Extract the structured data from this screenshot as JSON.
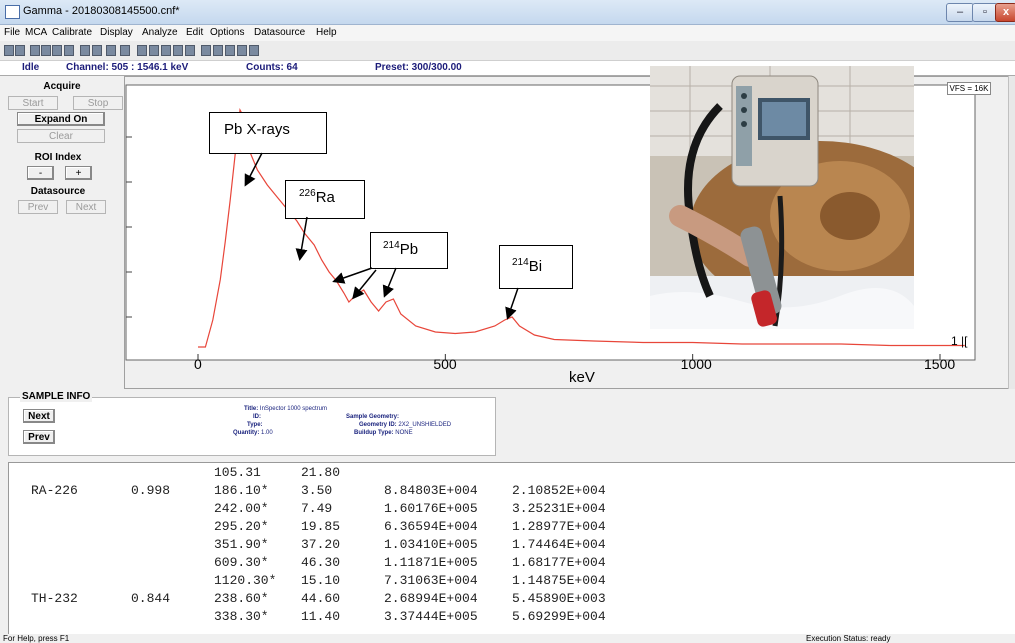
{
  "window": {
    "title": "Gamma - 20180308145500.cnf*",
    "min": "–",
    "max": "▫",
    "close": "x"
  },
  "menu": [
    "File",
    "MCA",
    "Calibrate",
    "Display",
    "Analyze",
    "Edit",
    "Options",
    "Datasource",
    "Help"
  ],
  "status": {
    "state": "Idle",
    "channel": "Channel: 505  : 1546.1 keV",
    "counts": "Counts: 64",
    "preset": "Preset: 300/300.00"
  },
  "acquire": {
    "heading": "Acquire",
    "start": "Start",
    "stop": "Stop",
    "expand": "Expand On",
    "clear": "Clear"
  },
  "roi": {
    "heading": "ROI Index",
    "minus": "-",
    "plus": "+"
  },
  "datasource": {
    "heading": "Datasource",
    "prev": "Prev",
    "next": "Next"
  },
  "plot": {
    "vfs": "VFS = 16K",
    "cursor_marker": "1 |["
  },
  "chart_data": {
    "type": "line",
    "xlabel": "keV",
    "xlim": [
      0,
      1550
    ],
    "xticks": [
      "0",
      "500",
      "1000",
      "1500"
    ],
    "series": [
      {
        "x": [
          0,
          15,
          30,
          45,
          55,
          65,
          75,
          85,
          95,
          105,
          120,
          140,
          160,
          180,
          200,
          215,
          235,
          250,
          265,
          280,
          295,
          305,
          320,
          335,
          350,
          365,
          380,
          395,
          410,
          440,
          480,
          520,
          560,
          600,
          620,
          635,
          650,
          680,
          720,
          800,
          900,
          1000,
          1100,
          1200,
          1300,
          1400,
          1500,
          1550
        ],
        "y": [
          0,
          0,
          18,
          45,
          70,
          98,
          128,
          158,
          152,
          130,
          118,
          108,
          100,
          92,
          84,
          76,
          68,
          58,
          50,
          44,
          36,
          30,
          35,
          38,
          30,
          24,
          30,
          32,
          22,
          14,
          10,
          9,
          10,
          14,
          18,
          20,
          14,
          8,
          5,
          4,
          3,
          3,
          2,
          2,
          2,
          1,
          1,
          1
        ],
        "color": "#e8463a"
      }
    ],
    "annotations": [
      {
        "label": "Pb X-rays",
        "sup": "",
        "x": 85
      },
      {
        "label": "Ra",
        "sup": "226",
        "x": 186
      },
      {
        "label": "Pb",
        "sup": "214",
        "x": 295
      },
      {
        "label": "Bi",
        "sup": "214",
        "x": 609
      }
    ]
  },
  "sample_info": {
    "legend": "SAMPLE INFO",
    "next": "Next",
    "prev": "Prev",
    "title_label": "Title:",
    "title_value": "InSpector 1000 spectrum",
    "id_label": "ID:",
    "type_label": "Type:",
    "quantity_label": "Quantity:",
    "quantity_value": "1.00",
    "geometry_label": "Sample Geometry:",
    "geometry_id_label": "Geometry ID:",
    "geometry_id_value": "2X2_UNSHIELDED",
    "buildup_label": "Buildup Type:",
    "buildup_value": "NONE"
  },
  "report": {
    "rows": [
      {
        "nuclide": "",
        "conf": "",
        "energy": "105.31",
        "yield": "21.80",
        "act": "",
        "err": ""
      },
      {
        "nuclide": "RA-226",
        "conf": "0.998",
        "energy": "186.10*",
        "yield": "3.50",
        "act": "8.84803E+004",
        "err": "2.10852E+004"
      },
      {
        "nuclide": "",
        "conf": "",
        "energy": "242.00*",
        "yield": "7.49",
        "act": "1.60176E+005",
        "err": "3.25231E+004"
      },
      {
        "nuclide": "",
        "conf": "",
        "energy": "295.20*",
        "yield": "19.85",
        "act": "6.36594E+004",
        "err": "1.28977E+004"
      },
      {
        "nuclide": "",
        "conf": "",
        "energy": "351.90*",
        "yield": "37.20",
        "act": "1.03410E+005",
        "err": "1.74464E+004"
      },
      {
        "nuclide": "",
        "conf": "",
        "energy": "609.30*",
        "yield": "46.30",
        "act": "1.11871E+005",
        "err": "1.68177E+004"
      },
      {
        "nuclide": "",
        "conf": "",
        "energy": "1120.30*",
        "yield": "15.10",
        "act": "7.31063E+004",
        "err": "1.14875E+004"
      },
      {
        "nuclide": "TH-232",
        "conf": "0.844",
        "energy": "238.60*",
        "yield": "44.60",
        "act": "2.68994E+004",
        "err": "5.45890E+003"
      },
      {
        "nuclide": "",
        "conf": "",
        "energy": "338.30*",
        "yield": "11.40",
        "act": "3.37444E+005",
        "err": "5.69299E+004"
      }
    ]
  },
  "statusbar": {
    "help": "For Help, press F1",
    "exec": "Execution Status: ready"
  }
}
